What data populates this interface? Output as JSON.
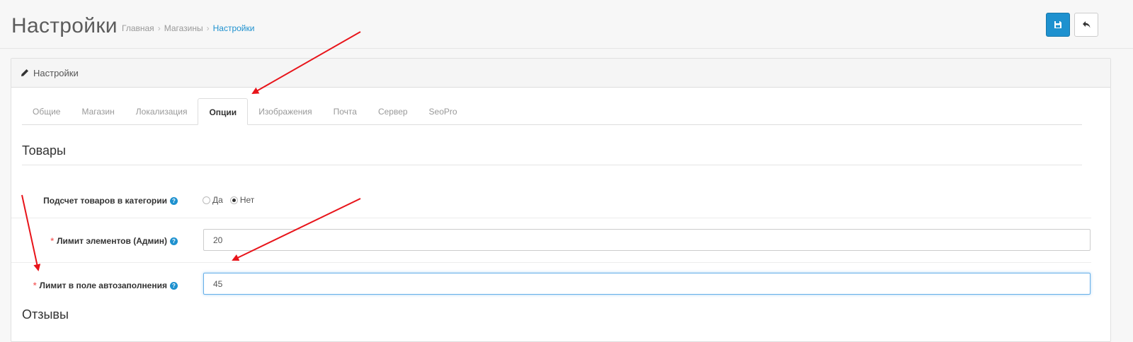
{
  "header": {
    "title": "Настройки",
    "breadcrumbs": [
      "Главная",
      "Магазины",
      "Настройки"
    ],
    "breadcrumb_separator": "›",
    "save_icon": "floppy-disk-icon",
    "back_icon": "reply-icon"
  },
  "panel": {
    "heading": "Настройки",
    "heading_icon": "pencil-icon"
  },
  "tabs": [
    {
      "label": "Общие"
    },
    {
      "label": "Магазин"
    },
    {
      "label": "Локализация"
    },
    {
      "label": "Опции",
      "active": true
    },
    {
      "label": "Изображения"
    },
    {
      "label": "Почта"
    },
    {
      "label": "Сервер"
    },
    {
      "label": "SeoPro"
    }
  ],
  "sections": {
    "products": "Товары",
    "reviews": "Отзывы"
  },
  "fields": {
    "product_count": {
      "label": "Подсчет товаров в категории",
      "options": [
        "Да",
        "Нет"
      ],
      "selected": "Нет"
    },
    "admin_limit": {
      "required_mark": "*",
      "label": "Лимит элементов (Админ)",
      "value": "20"
    },
    "autocomplete_limit": {
      "required_mark": "*",
      "label": "Лимит в поле автозаполнения",
      "value": "45"
    }
  },
  "colors": {
    "primary": "#1e91cf",
    "annotation_arrow": "#e8141a",
    "required": "#f56b6b"
  }
}
